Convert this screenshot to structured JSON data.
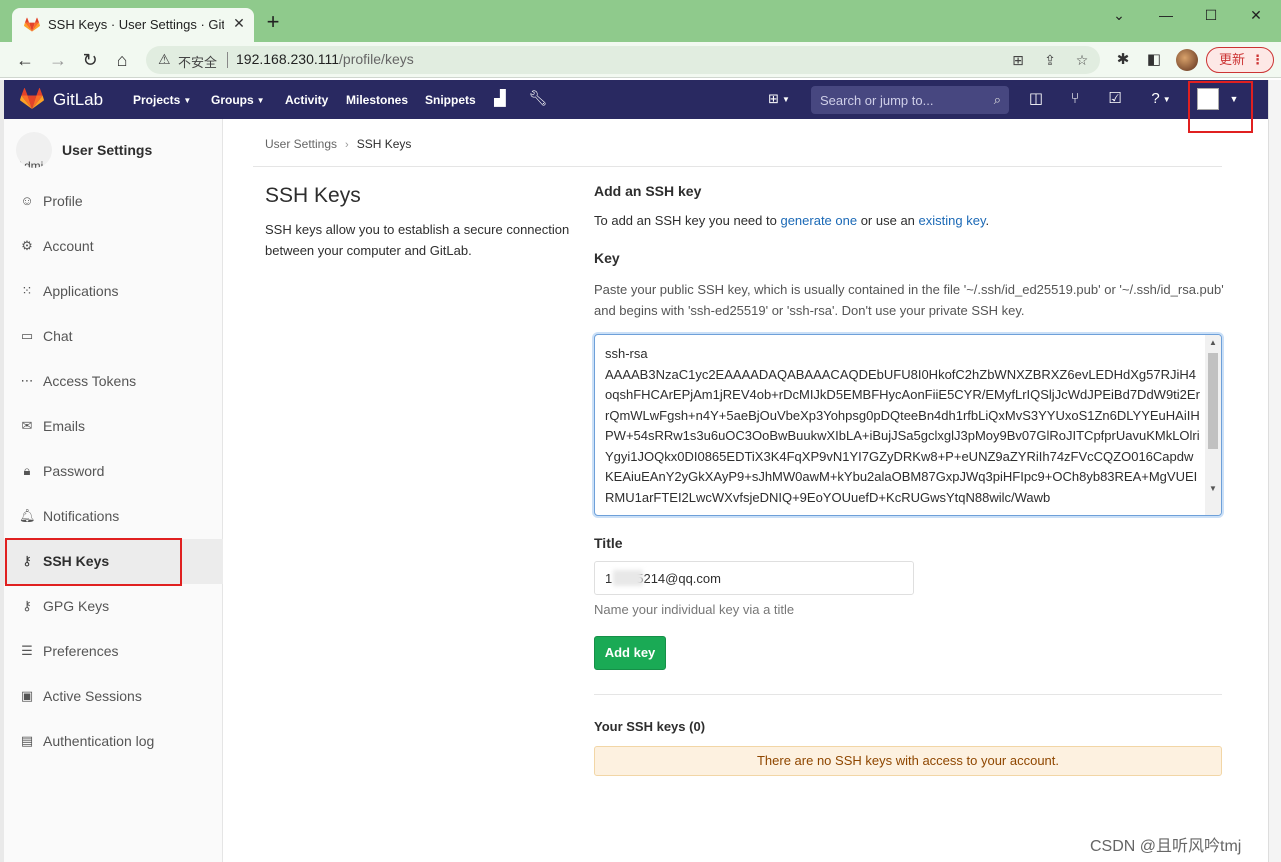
{
  "browser": {
    "tab_title": "SSH Keys · User Settings · GitLab",
    "tab_close": "✕",
    "new_tab": "+",
    "insecure_label": "不安全",
    "url_host": "192.168.230.111",
    "url_path": "/profile/keys",
    "update_label": "更新",
    "update_dots": "⋮"
  },
  "gitlab_header": {
    "brand": "GitLab",
    "nav": [
      "Projects",
      "Groups",
      "Activity",
      "Milestones",
      "Snippets"
    ],
    "search_placeholder": "Search or jump to..."
  },
  "sidebar": {
    "avatar_alt": "Admi",
    "title": "User Settings",
    "items": [
      {
        "label": "Profile",
        "icon": "profile-icon"
      },
      {
        "label": "Account",
        "icon": "account-icon"
      },
      {
        "label": "Applications",
        "icon": "applications-icon"
      },
      {
        "label": "Chat",
        "icon": "chat-icon"
      },
      {
        "label": "Access Tokens",
        "icon": "token-icon"
      },
      {
        "label": "Emails",
        "icon": "email-icon"
      },
      {
        "label": "Password",
        "icon": "lock-icon"
      },
      {
        "label": "Notifications",
        "icon": "bell-icon"
      },
      {
        "label": "SSH Keys",
        "icon": "key-icon"
      },
      {
        "label": "GPG Keys",
        "icon": "key-icon"
      },
      {
        "label": "Preferences",
        "icon": "preferences-icon"
      },
      {
        "label": "Active Sessions",
        "icon": "monitor-icon"
      },
      {
        "label": "Authentication log",
        "icon": "log-icon"
      }
    ]
  },
  "breadcrumb": {
    "parent": "User Settings",
    "current": "SSH Keys"
  },
  "page": {
    "title": "SSH Keys",
    "description": "SSH keys allow you to establish a secure connection between your computer and GitLab."
  },
  "add_key": {
    "heading": "Add an SSH key",
    "intro_prefix": "To add an SSH key you need to ",
    "generate_link": "generate one",
    "intro_middle": " or use an ",
    "existing_link": "existing key",
    "intro_suffix": ".",
    "key_label": "Key",
    "key_help": "Paste your public SSH key, which is usually contained in the file '~/.ssh/id_ed25519.pub' or '~/.ssh/id_rsa.pub' and begins with 'ssh-ed25519' or 'ssh-rsa'. Don't use your private SSH key.",
    "key_value_line1": "ssh-rsa",
    "key_value_body": "AAAAB3NzaC1yc2EAAAADAQABAAACAQDEbUFU8I0HkofC2hZbWNXZBRXZ6evLEDHdXg57RJiH4oqshFHCArEPjAm1jREV4ob+rDcMIJkD5EMBFHycAonFiiE5CYR/EMyfLrIQSljJcWdJPEiBd7DdW9ti2ErrQmWLwFgsh+n4Y+5aeBjOuVbeXp3Yohpsg0pDQteeBn4dh1rfbLiQxMvS3YYUxoS1Zn6DLYYEuHAiIHPW+54sRRw1s3u6uOC3OoBwBuukwXIbLA+iBujJSa5gclxglJ3pMoy9Bv07GlRoJITCpfprUavuKMkLOlriYgyi1JOQkx0DI0865EDTiX3K4FqXP9vN1YI7GZyDRKw8+P+eUNZ9aZYRiIh74zFVcCQZO016CapdwKEAiuEAnY2yGkXAyP9+sJhMW0awM+kYbu2alaOBM87GxpJWq3piHFIpc9+OCh8yb83REA+MgVUEIRMU1arFTEI2LwcWXvfsjeDNIQ+9EoYOUuefD+KcRUGwsYtqN88wilc/Wawb",
    "title_label": "Title",
    "title_value_prefix": "1",
    "title_value_suffix": "5214@qq.com",
    "title_help": "Name your individual key via a title",
    "add_button": "Add key"
  },
  "your_keys": {
    "heading": "Your SSH keys (0)",
    "empty_message": "There are no SSH keys with access to your account."
  },
  "watermark": "CSDN @且听风吟tmj",
  "colors": {
    "header_bg": "#292961",
    "primary_green": "#1aaa55",
    "link_blue": "#1b69b6",
    "highlight_red": "#e02020"
  }
}
